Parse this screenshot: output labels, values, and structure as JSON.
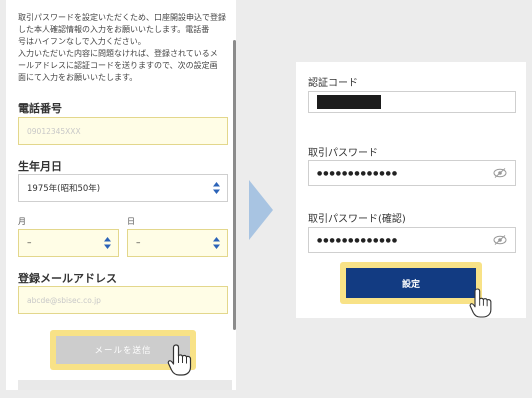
{
  "left": {
    "intro_lines": [
      "取引パスワードを設定いただくため、口座開設申込で登録",
      "した本人確認情報の入力をお願いいたします。電話番",
      "号はハイフンなしで入力ください。",
      "入力いただいた内容に問題なければ、登録されているメ",
      "ールアドレスに認証コードを送りますので、次の設定画",
      "面にて入力をお願いいたします。"
    ],
    "phone_label": "電話番号",
    "phone_placeholder": "09012345XXX",
    "birthdate_label": "生年月日",
    "year_value": "1975年(昭和50年)",
    "month_label": "月",
    "month_value": "–",
    "day_label": "日",
    "day_value": "–",
    "email_label": "登録メールアドレス",
    "email_placeholder": "abcde@sbisec.co.jp",
    "send_button": "メールを送信"
  },
  "right": {
    "code_label": "認証コード",
    "password_label": "取引パスワード",
    "password_value": "●●●●●●●●●●●●●",
    "password_confirm_label": "取引パスワード(確認)",
    "password_confirm_value": "●●●●●●●●●●●●●",
    "set_button": "設定"
  },
  "colors": {
    "accent_yellow": "#f8e287",
    "button_blue": "#123b82",
    "arrow_blue": "#a8c4e2",
    "input_yellow_bg": "#fffde6"
  },
  "icons": [
    "chevron-updown-icon",
    "eye-slash-icon",
    "pointing-hand-icon",
    "right-arrow-icon"
  ]
}
